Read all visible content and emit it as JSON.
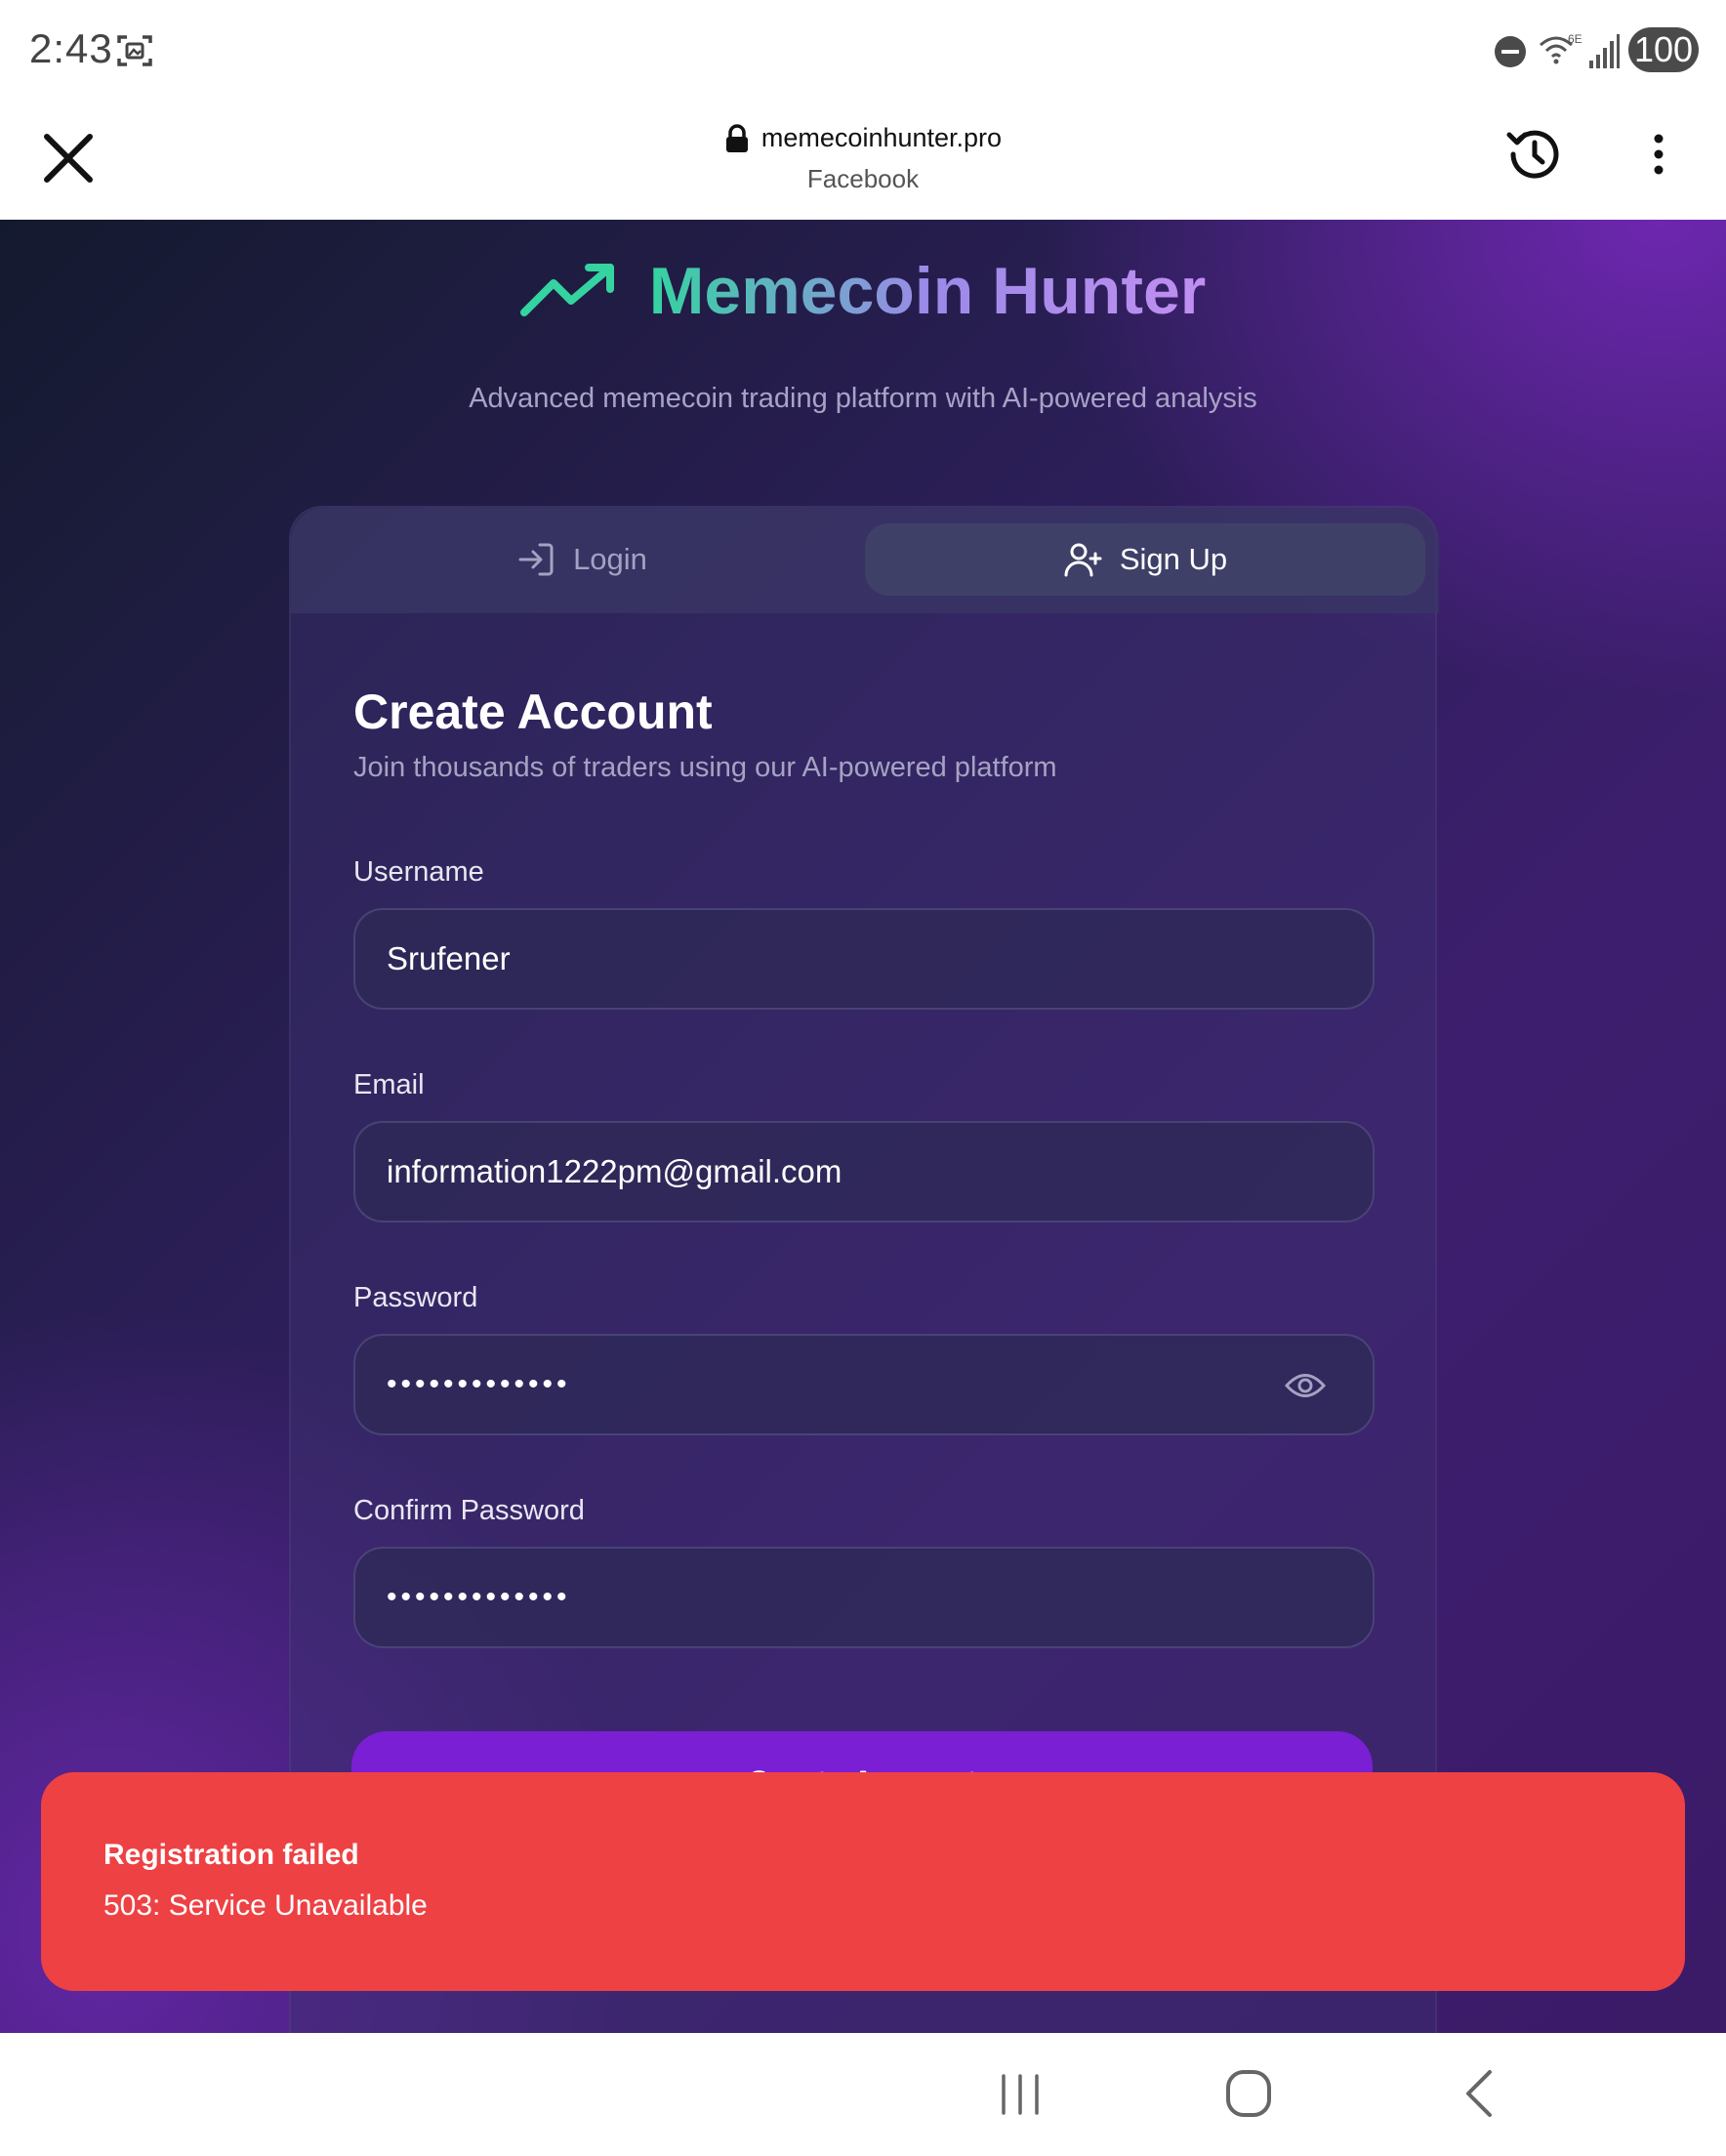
{
  "status_bar": {
    "time": "2:43",
    "battery": "100",
    "network": "6E"
  },
  "browser": {
    "url": "memecoinhunter.pro",
    "subtitle": "Facebook"
  },
  "brand": {
    "title": "Memecoin Hunter",
    "tagline": "Advanced memecoin trading platform with AI-powered analysis"
  },
  "tabs": {
    "login": "Login",
    "signup": "Sign Up",
    "active": "signup"
  },
  "form": {
    "title": "Create Account",
    "subtitle": "Join thousands of traders using our AI-powered platform",
    "username_label": "Username",
    "username_value": "Srufener",
    "email_label": "Email",
    "email_value": "information1222pm@gmail.com",
    "password_label": "Password",
    "password_value": "•••••••••••••",
    "confirm_label": "Confirm Password",
    "confirm_value": "•••••••••••••",
    "submit_label": "Create Account"
  },
  "toast": {
    "title": "Registration failed",
    "message": "503: Service Unavailable",
    "color": "#ee4144"
  },
  "colors": {
    "accent_green": "#34d3a0",
    "accent_purple": "#7a1fd4"
  },
  "icons": [
    "screenshot-icon",
    "dnd-icon",
    "wifi-icon",
    "signal-icon",
    "close-icon",
    "lock-icon",
    "history-icon",
    "menu-icon",
    "trend-icon",
    "login-icon",
    "add-user-icon",
    "eye-icon",
    "recents-icon",
    "home-icon",
    "back-icon"
  ]
}
